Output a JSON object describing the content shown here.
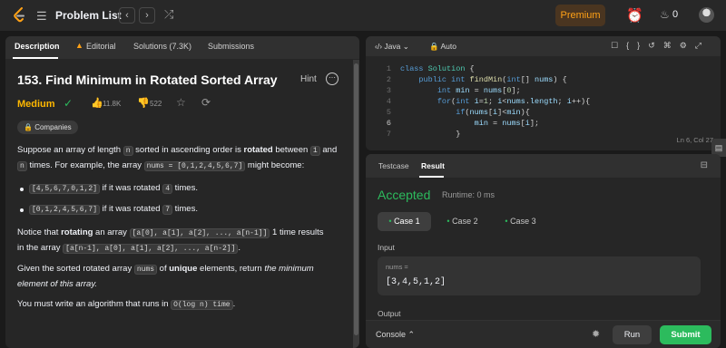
{
  "topbar": {
    "title": "Problem List",
    "premium": "Premium",
    "streak": "0"
  },
  "left_tabs": [
    {
      "label": "Description"
    },
    {
      "label": "Editorial"
    },
    {
      "label": "Solutions (7.3K)"
    },
    {
      "label": "Submissions"
    }
  ],
  "problem": {
    "title": "153. Find Minimum in Rotated Sorted Array",
    "hint": "Hint",
    "difficulty": "Medium",
    "likes": "11.8K",
    "dislikes": "522",
    "companies": "Companies"
  },
  "description": {
    "p1": {
      "a": "Suppose an array of length ",
      "n": "n",
      "b": " sorted in ascending order is ",
      "rotated": "rotated",
      "c": " between ",
      "one": "1",
      "d": " and",
      "n2": "n",
      "e": " times. For example, the array ",
      "nums": "nums = [0,1,2,4,5,6,7]",
      "f": " might become:"
    },
    "bullets": [
      {
        "code": "[4,5,6,7,0,1,2]",
        "pre": " if it was rotated ",
        "num": "4",
        "post": " times."
      },
      {
        "code": "[0,1,2,4,5,6,7]",
        "pre": " if it was rotated ",
        "num": "7",
        "post": " times."
      }
    ],
    "p2": {
      "a": "Notice that ",
      "rotating": "rotating",
      "b": " an array ",
      "arr": "[a[0], a[1], a[2], ..., a[n-1]]",
      "c": " 1 time results",
      "d": "in the array ",
      "arr2": "[a[n-1], a[0], a[1], a[2], ..., a[n-2]]",
      "e": "."
    },
    "p3": {
      "a": "Given the sorted rotated array ",
      "nums": "nums",
      "b": " of ",
      "unique": "unique",
      "c": " elements, return ",
      "ital": "the minimum element of this array",
      "d": "."
    },
    "p4": {
      "a": "You must write an algorithm that runs in ",
      "code": "O(log n) time",
      "b": "."
    }
  },
  "editor": {
    "language": "Java",
    "mode": "Auto",
    "line_numbers": [
      "1",
      "2",
      "3",
      "4",
      "5",
      "6",
      "7"
    ],
    "cursor": "Ln 6, Col 27"
  },
  "result": {
    "tabs": [
      "Testcase",
      "Result"
    ],
    "status": "Accepted",
    "runtime": "Runtime: 0 ms",
    "cases": [
      "Case 1",
      "Case 2",
      "Case 3"
    ],
    "input_label": "Input",
    "var_name": "nums =",
    "var_value": "[3,4,5,1,2]",
    "output_label": "Output"
  },
  "footer": {
    "console": "Console",
    "run": "Run",
    "submit": "Submit"
  },
  "colors": {
    "accent": "#ffa116",
    "medium": "#ffb800",
    "accepted": "#2cbb5d"
  }
}
